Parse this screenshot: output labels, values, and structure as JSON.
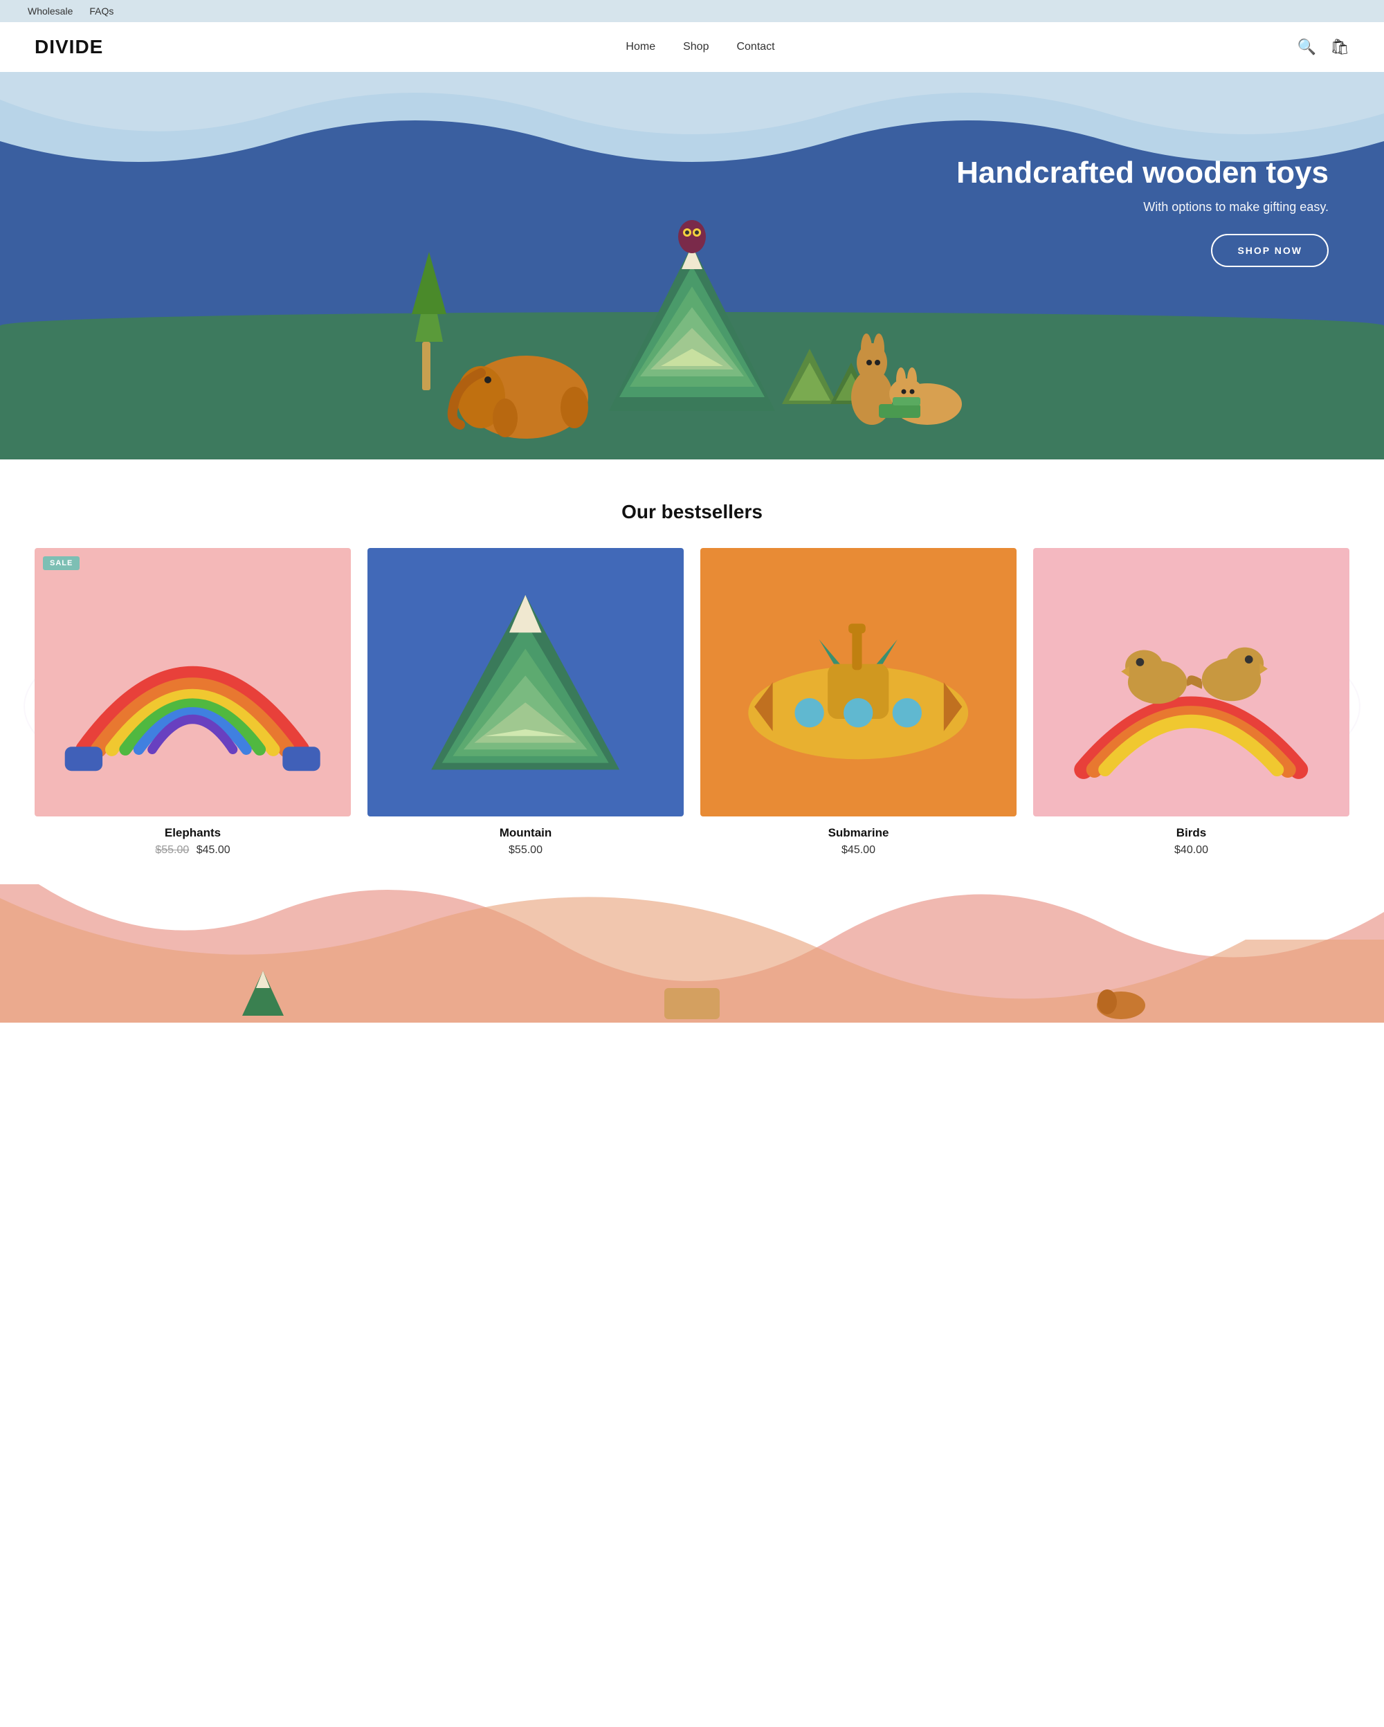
{
  "topbar": {
    "links": [
      "Wholesale",
      "FAQs"
    ]
  },
  "header": {
    "logo": "DIVIDE",
    "nav": [
      "Home",
      "Shop",
      "Contact"
    ],
    "icons": [
      "search",
      "cart"
    ]
  },
  "hero": {
    "heading": "Handcrafted wooden toys",
    "subheading": "With options to make gifting easy.",
    "cta_label": "SHOP NOW"
  },
  "bestsellers": {
    "title": "Our bestsellers",
    "products": [
      {
        "name": "Elephants",
        "price": "$45.00",
        "original_price": "$55.00",
        "on_sale": true,
        "bg": "pink"
      },
      {
        "name": "Mountain",
        "price": "$55.00",
        "original_price": null,
        "on_sale": false,
        "bg": "blue"
      },
      {
        "name": "Submarine",
        "price": "$45.00",
        "original_price": null,
        "on_sale": false,
        "bg": "orange"
      },
      {
        "name": "Birds",
        "price": "$40.00",
        "original_price": null,
        "on_sale": false,
        "bg": "lightpink"
      }
    ]
  }
}
